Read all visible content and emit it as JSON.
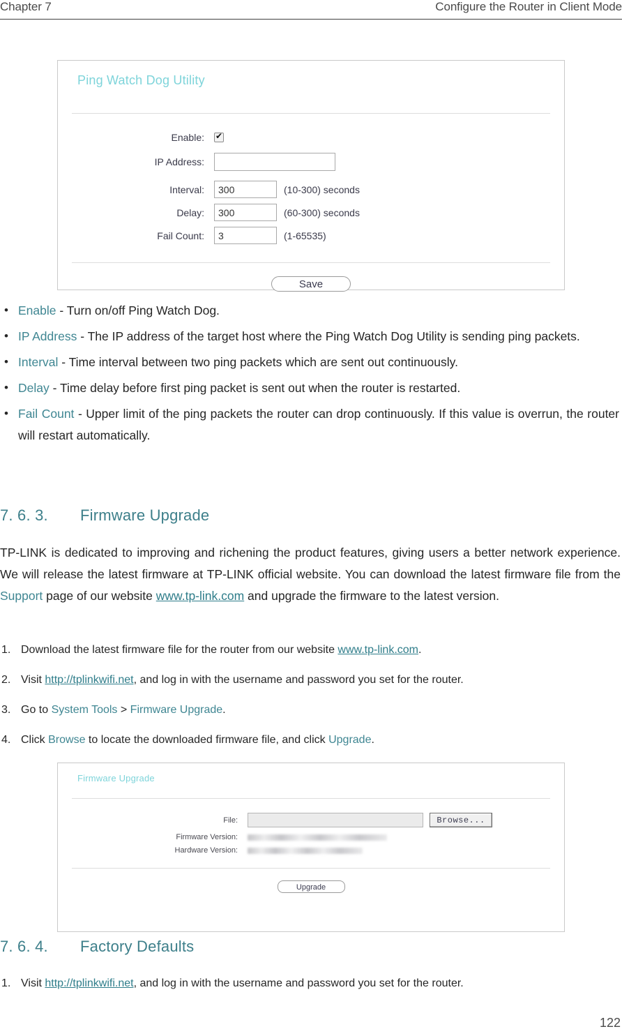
{
  "header": {
    "chapter": "Chapter 7",
    "title": "Configure the Router in Client Mode"
  },
  "ping_watchdog_panel": {
    "title": "Ping Watch Dog Utility",
    "fields": {
      "enable_label": "Enable:",
      "enable_checked": true,
      "ip_label": "IP Address:",
      "ip_value": "",
      "interval_label": "Interval:",
      "interval_value": "300",
      "interval_hint": "(10-300) seconds",
      "delay_label": "Delay:",
      "delay_value": "300",
      "delay_hint": "(60-300) seconds",
      "fail_label": "Fail Count:",
      "fail_value": "3",
      "fail_hint": "(1-65535)"
    },
    "save_label": "Save"
  },
  "bullets": [
    {
      "term": "Enable",
      "text": " - Turn on/off Ping Watch Dog."
    },
    {
      "term": "IP Address",
      "text": " - The IP address of the target host where the Ping Watch Dog Utility is sending ping packets."
    },
    {
      "term": "Interval",
      "text": " - Time interval between two ping packets which are sent out continuously."
    },
    {
      "term": "Delay",
      "text": " - Time delay before first ping packet is sent out when the router is restarted."
    },
    {
      "term": "Fail Count",
      "text": " - Upper limit of the ping packets the router can drop continuously. If this value is overrun, the router will restart automatically."
    }
  ],
  "firmware_section": {
    "number": "7. 6. 3.",
    "title": "Firmware Upgrade",
    "paragraph_part1": "TP-LINK is dedicated to improving and richening the product features, giving users a better network experience. We will release the latest firmware at TP-LINK official website. You can download the latest firmware file from the ",
    "paragraph_link1": "Support",
    "paragraph_part2": " page of our website ",
    "paragraph_link2": "www.tp-link.com",
    "paragraph_part3": " and upgrade the firmware to the latest version.",
    "steps": [
      {
        "index": "1.",
        "before": "Download the latest firmware file for the router from our website ",
        "link": "www.tp-link.com",
        "after": "."
      },
      {
        "index": "2.",
        "before": "Visit ",
        "link": "http://tplinkwifi.net",
        "after": ", and log in with the username and password you set for the router."
      },
      {
        "index": "3.",
        "before": "Go to ",
        "teal1": "System Tools",
        "middle": " > ",
        "teal2": "Firmware Upgrade",
        "after": "."
      },
      {
        "index": "4.",
        "before": "Click ",
        "teal1": "Browse",
        "middle": " to locate the downloaded firmware file, and click ",
        "teal2": "Upgrade",
        "after": "."
      }
    ]
  },
  "firmware_panel": {
    "title": "Firmware Upgrade",
    "file_label": "File:",
    "file_value": "",
    "browse_label": "Browse...",
    "firmware_version_label": "Firmware Version:",
    "firmware_version_value": "",
    "hardware_version_label": "Hardware Version:",
    "hardware_version_value": "",
    "upgrade_label": "Upgrade"
  },
  "factory_section": {
    "number": "7. 6. 4.",
    "title": "Factory Defaults",
    "steps": [
      {
        "index": "1.",
        "before": "Visit ",
        "link": "http://tplinkwifi.net",
        "after": ", and log in with the username and password you set for the router."
      }
    ]
  },
  "page_number": "122"
}
